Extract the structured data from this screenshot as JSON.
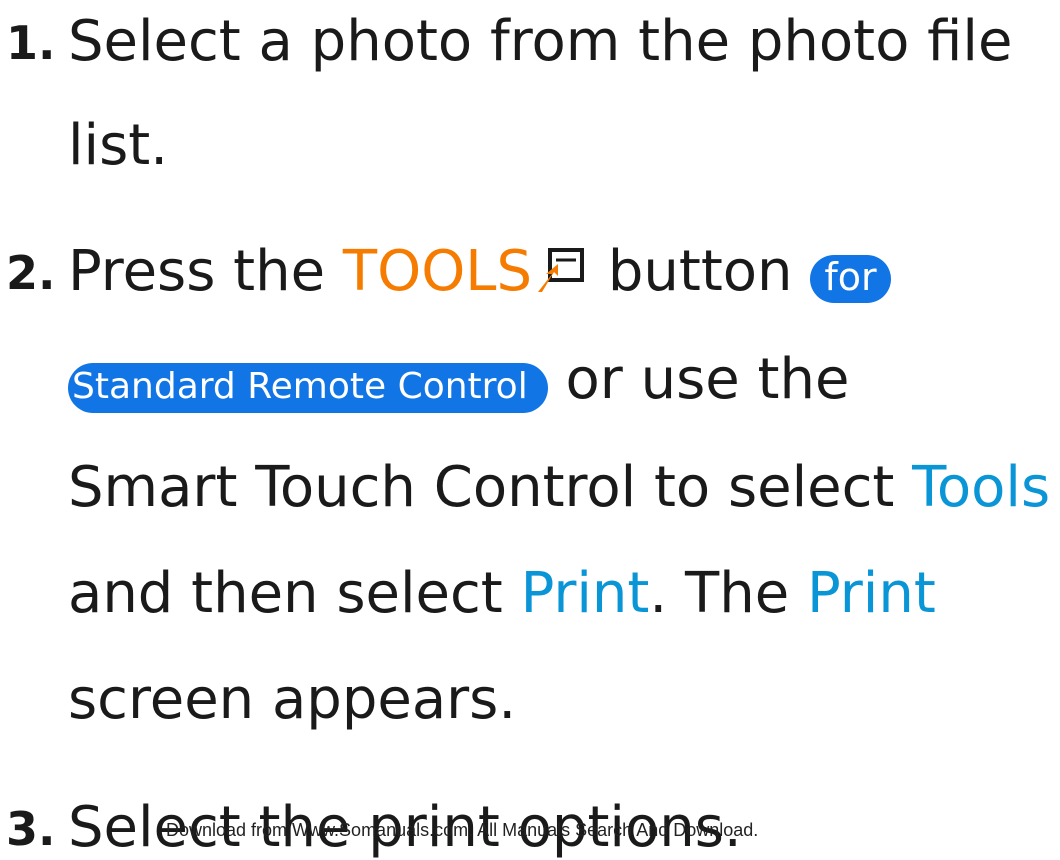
{
  "step1": {
    "number": "1.",
    "line1": "Select a photo from the photo file",
    "line2": "list."
  },
  "step2": {
    "number": "2.",
    "press_the": "Press the",
    "tools_label": "TOOLS",
    "button_text": "button",
    "for_badge": "for",
    "remote_badge": "Standard Remote Control",
    "or_use_the": "or use the",
    "line3_text": "Smart Touch Control to select",
    "tools_menu": "Tools",
    "and_then_select": "and then select",
    "print_1": "Print",
    "the_text": ". The",
    "print_2": "Print",
    "screen_appears": "screen appears."
  },
  "step3": {
    "number": "3.",
    "text": "Select the print options."
  },
  "watermark": "Download from Www.Somanuals.com. All Manuals Search And Download.",
  "colors": {
    "orange": "#f57c00",
    "blue": "#0a95d6",
    "badge": "#1175e6"
  },
  "icons": {
    "tools": "tools-icon"
  }
}
